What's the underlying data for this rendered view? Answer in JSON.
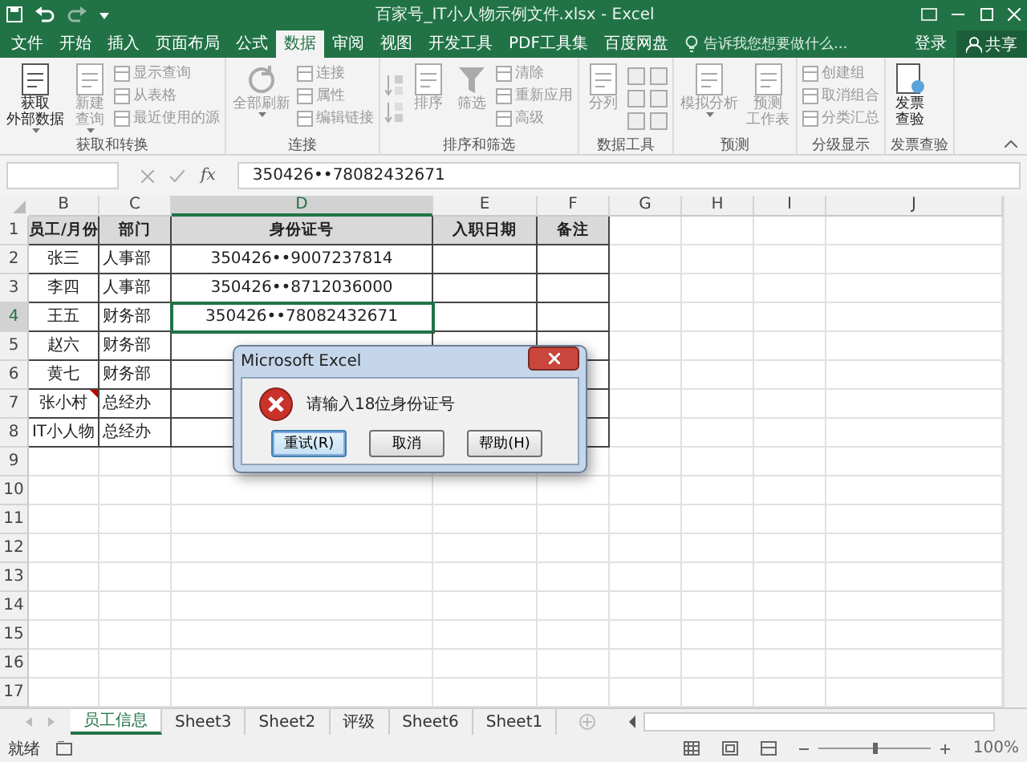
{
  "window": {
    "title": "百家号_IT小人物示例文件.xlsx - Excel"
  },
  "tabs": [
    {
      "label": "文件",
      "selected": false
    },
    {
      "label": "开始",
      "selected": false
    },
    {
      "label": "插入",
      "selected": false
    },
    {
      "label": "页面布局",
      "selected": false
    },
    {
      "label": "公式",
      "selected": false
    },
    {
      "label": "数据",
      "selected": true
    },
    {
      "label": "审阅",
      "selected": false
    },
    {
      "label": "视图",
      "selected": false
    },
    {
      "label": "开发工具",
      "selected": false
    },
    {
      "label": "PDF工具集",
      "selected": false
    },
    {
      "label": "百度网盘",
      "selected": false
    }
  ],
  "tell_me": {
    "placeholder": "告诉我您想要做什么..."
  },
  "sign_in": "登录",
  "share": "共享",
  "ribbon_groups": [
    {
      "label": "获取和转换",
      "items": [
        {
          "kind": "big",
          "lines": [
            "获取",
            "外部数据"
          ],
          "caret": true,
          "disabled": false
        },
        {
          "kind": "big",
          "lines": [
            "新建",
            "查询"
          ],
          "caret": true,
          "disabled": true
        },
        {
          "kind": "smalls",
          "items": [
            "显示查询",
            "从表格",
            "最近使用的源"
          ],
          "disabled": true
        }
      ]
    },
    {
      "label": "连接",
      "items": [
        {
          "kind": "big",
          "lines": [
            "全部刷新"
          ],
          "caret": true,
          "disabled": true
        },
        {
          "kind": "smalls",
          "items": [
            "连接",
            "属性",
            "编辑链接"
          ],
          "disabled": true
        }
      ]
    },
    {
      "label": "排序和筛选",
      "items": [
        {
          "kind": "sorticons",
          "disabled": true
        },
        {
          "kind": "big",
          "lines": [
            "排序"
          ],
          "caret": false,
          "disabled": true
        },
        {
          "kind": "big",
          "lines": [
            "筛选"
          ],
          "caret": false,
          "disabled": true
        },
        {
          "kind": "smalls",
          "items": [
            "清除",
            "重新应用",
            "高级"
          ],
          "disabled": true
        }
      ]
    },
    {
      "label": "数据工具",
      "items": [
        {
          "kind": "big",
          "lines": [
            "分列"
          ],
          "caret": false,
          "disabled": true
        },
        {
          "kind": "toolicons",
          "disabled": true
        }
      ]
    },
    {
      "label": "预测",
      "items": [
        {
          "kind": "big",
          "lines": [
            "模拟分析"
          ],
          "caret": true,
          "disabled": true
        },
        {
          "kind": "big",
          "lines": [
            "预测",
            "工作表"
          ],
          "caret": false,
          "disabled": true
        }
      ]
    },
    {
      "label": "分级显示",
      "items": [
        {
          "kind": "smalls",
          "items": [
            "创建组",
            "取消组合",
            "分类汇总"
          ],
          "disabled": true
        }
      ]
    },
    {
      "label": "发票查验",
      "items": [
        {
          "kind": "big",
          "lines": [
            "发票",
            "查验"
          ],
          "caret": false,
          "disabled": false
        }
      ]
    }
  ],
  "formula_bar": {
    "fx": "fx",
    "value": "350426••78082432671"
  },
  "columns": [
    {
      "label": "B",
      "selected": false
    },
    {
      "label": "C",
      "selected": false
    },
    {
      "label": "D",
      "selected": true
    },
    {
      "label": "E",
      "selected": false
    },
    {
      "label": "F",
      "selected": false
    },
    {
      "label": "G",
      "selected": false
    },
    {
      "label": "H",
      "selected": false
    },
    {
      "label": "I",
      "selected": false
    },
    {
      "label": "J",
      "selected": false
    }
  ],
  "rows": [
    {
      "number": "1",
      "selected": false,
      "cells": [
        {
          "text": "员工/月份",
          "header": true
        },
        {
          "text": "部门",
          "header": true
        },
        {
          "text": "身份证号",
          "header": true
        },
        {
          "text": "入职日期",
          "header": true
        },
        {
          "text": "备注",
          "header": true
        }
      ]
    },
    {
      "number": "2",
      "selected": false,
      "cells": [
        {
          "text": "张三"
        },
        {
          "text": "人事部"
        },
        {
          "text": "350426••9007237814"
        },
        {
          "text": ""
        },
        {
          "text": ""
        }
      ]
    },
    {
      "number": "3",
      "selected": false,
      "cells": [
        {
          "text": "李四"
        },
        {
          "text": "人事部"
        },
        {
          "text": "350426••8712036000"
        },
        {
          "text": ""
        },
        {
          "text": ""
        }
      ]
    },
    {
      "number": "4",
      "selected": true,
      "cells": [
        {
          "text": "王五"
        },
        {
          "text": "财务部"
        },
        {
          "text": "350426••78082432671",
          "selected": true
        },
        {
          "text": ""
        },
        {
          "text": ""
        }
      ]
    },
    {
      "number": "5",
      "selected": false,
      "cells": [
        {
          "text": "赵六"
        },
        {
          "text": "财务部"
        },
        {
          "text": ""
        },
        {
          "text": ""
        },
        {
          "text": ""
        }
      ]
    },
    {
      "number": "6",
      "selected": false,
      "cells": [
        {
          "text": "黄七"
        },
        {
          "text": "财务部"
        },
        {
          "text": ""
        },
        {
          "text": ""
        },
        {
          "text": ""
        }
      ]
    },
    {
      "number": "7",
      "selected": false,
      "cells": [
        {
          "text": "张小村",
          "comment": true
        },
        {
          "text": "总经办"
        },
        {
          "text": ""
        },
        {
          "text": ""
        },
        {
          "text": ""
        }
      ]
    },
    {
      "number": "8",
      "selected": false,
      "cells": [
        {
          "text": "IT小人物"
        },
        {
          "text": "总经办"
        },
        {
          "text": ""
        },
        {
          "text": ""
        },
        {
          "text": ""
        }
      ]
    },
    {
      "number": "9",
      "selected": false,
      "cells": []
    },
    {
      "number": "10",
      "selected": false,
      "cells": []
    },
    {
      "number": "11",
      "selected": false,
      "cells": []
    },
    {
      "number": "12",
      "selected": false,
      "cells": []
    },
    {
      "number": "13",
      "selected": false,
      "cells": []
    },
    {
      "number": "14",
      "selected": false,
      "cells": []
    },
    {
      "number": "15",
      "selected": false,
      "cells": []
    },
    {
      "number": "16",
      "selected": false,
      "cells": []
    },
    {
      "number": "17",
      "selected": false,
      "cells": []
    }
  ],
  "dialog": {
    "title": "Microsoft Excel",
    "message": "请输入18位身份证号",
    "buttons": [
      {
        "label": "重试(R)",
        "default": true
      },
      {
        "label": "取消",
        "default": false
      },
      {
        "label": "帮助(H)",
        "default": false
      }
    ]
  },
  "sheet_tabs": [
    {
      "label": "员工信息",
      "selected": true
    },
    {
      "label": "Sheet3",
      "selected": false
    },
    {
      "label": "Sheet2",
      "selected": false
    },
    {
      "label": "评级",
      "selected": false
    },
    {
      "label": "Sheet6",
      "selected": false
    },
    {
      "label": "Sheet1",
      "selected": false
    }
  ],
  "status_bar": {
    "status": "就绪",
    "zoom": "100%",
    "zoom_slider": {
      "level": 0.5
    }
  }
}
